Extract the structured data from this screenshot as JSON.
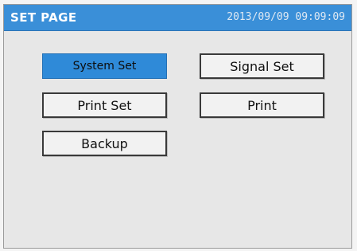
{
  "header": {
    "title": "SET PAGE",
    "datetime": "2013/09/09 09:09:09"
  },
  "menu": {
    "system_set": "System Set",
    "signal_set": "Signal Set",
    "print_set": "Print Set",
    "print": "Print",
    "backup": "Backup"
  },
  "colors": {
    "header_bg": "#3a8fd8",
    "selected_bg": "#2f8ad8",
    "panel_bg": "#e7e7e7"
  }
}
